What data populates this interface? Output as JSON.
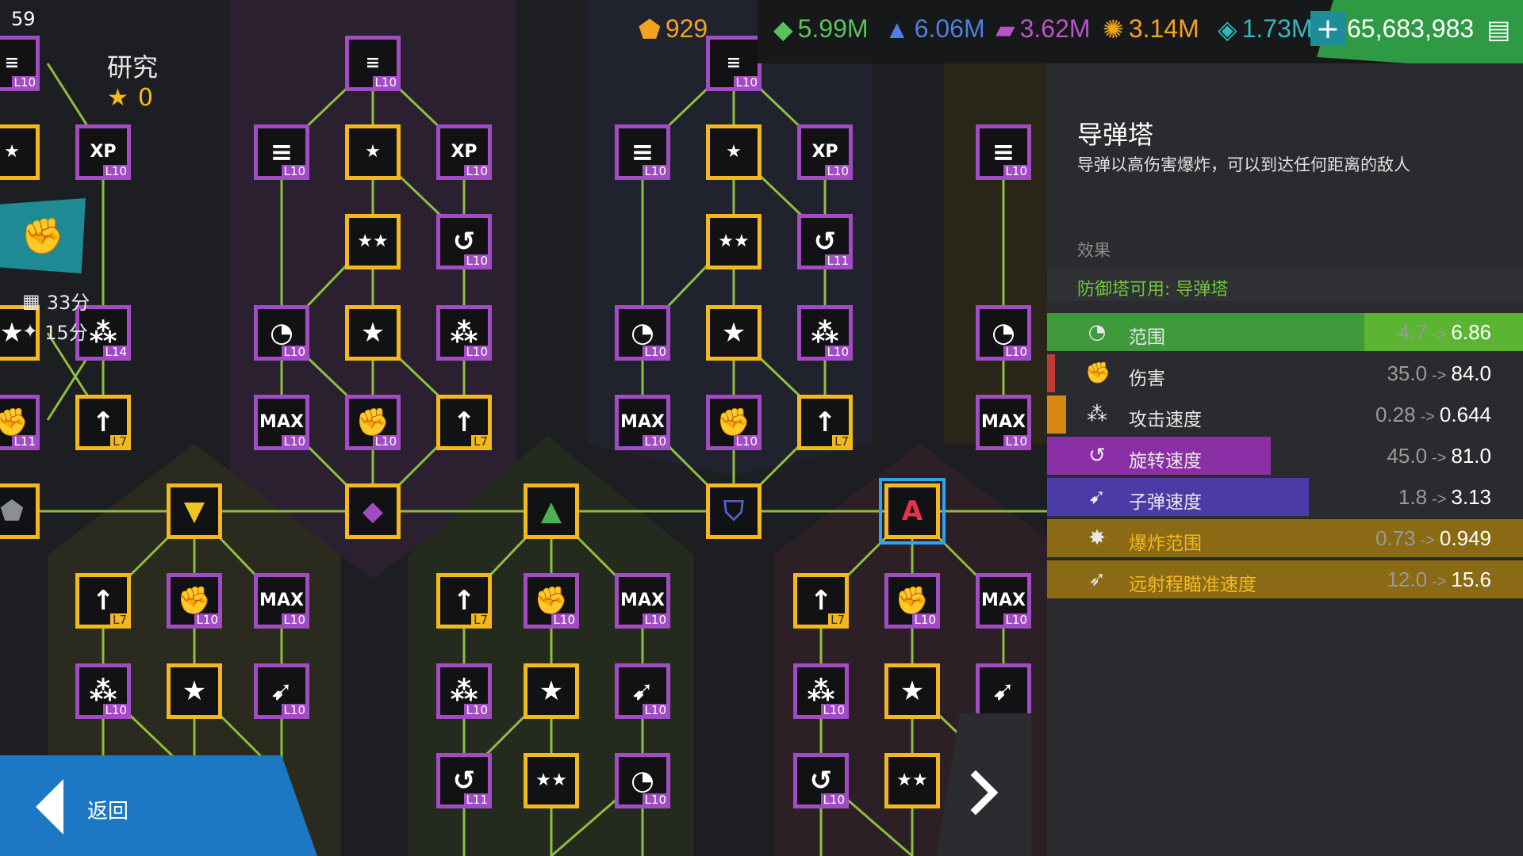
{
  "header": {
    "counter": "59",
    "title": "研究",
    "star_count": "0",
    "timer_1": "33分",
    "timer_2": "15分"
  },
  "resources": [
    {
      "icon": "pentagon-badge-icon",
      "value": "929",
      "color": "#f2a31e"
    },
    {
      "icon": "green-crystal-icon",
      "value": "5.99M",
      "color": "#59c35b"
    },
    {
      "icon": "blue-shard-icon",
      "value": "6.06M",
      "color": "#4f7fe0"
    },
    {
      "icon": "purple-stripes-icon",
      "value": "3.62M",
      "color": "#b655c9"
    },
    {
      "icon": "orange-mineral-icon",
      "value": "3.14M",
      "color": "#f2a31e"
    },
    {
      "icon": "teal-crystal-icon",
      "value": "1.73M",
      "color": "#34b7c0"
    },
    {
      "icon": "money-icon",
      "value": "65,683,983",
      "color": "#ffffff"
    }
  ],
  "panel": {
    "title": "导弹塔",
    "description": "导弹以高伤害爆炸，可以到达任何距离的敌人",
    "effects_label": "效果",
    "unlock_text": "防御塔可用: 导弹塔",
    "stats": [
      {
        "name": "范围",
        "icon": "range-icon",
        "from": "4.7",
        "to": "6.86",
        "color": "#3f9a3c",
        "fill": 1.0
      },
      {
        "name": "伤害",
        "icon": "damage-fist-icon",
        "from": "35.0",
        "to": "84.0",
        "color": "#c13a33",
        "fill": 0.01
      },
      {
        "name": "攻击速度",
        "icon": "attack-speed-icon",
        "from": "0.28",
        "to": "0.644",
        "color": "#d98714",
        "fill": 0.04
      },
      {
        "name": "旋转速度",
        "icon": "rotation-speed-icon",
        "from": "45.0",
        "to": "81.0",
        "color": "#8a2fa6",
        "fill": 0.47
      },
      {
        "name": "子弹速度",
        "icon": "bullet-speed-icon",
        "from": "1.8",
        "to": "3.13",
        "color": "#4c3ba6",
        "fill": 0.55
      },
      {
        "name": "爆炸范围",
        "icon": "explosion-range-icon",
        "from": "0.73",
        "to": "0.949",
        "color": "#8a6a14",
        "fill": 1.0
      },
      {
        "name": "远射程瞄准速度",
        "icon": "long-range-aim-icon",
        "from": "12.0",
        "to": "15.6",
        "color": "#8a6a14",
        "fill": 1.0
      }
    ]
  },
  "nav": {
    "back_label": "返回"
  },
  "tree_nodes": [
    {
      "name": "node-xp-l10",
      "glyph": "XP",
      "level": "L10",
      "gold": false
    },
    {
      "name": "node-star-stack",
      "glyph": "★",
      "level": "",
      "gold": true
    },
    {
      "name": "node-double-star",
      "glyph": "★★",
      "level": "",
      "gold": true
    },
    {
      "name": "node-range",
      "glyph": "◔",
      "level": "L10",
      "gold": false
    },
    {
      "name": "node-star",
      "glyph": "★",
      "level": "",
      "gold": true
    },
    {
      "name": "node-attack-speed",
      "glyph": "⁂",
      "level": "L10",
      "gold": false
    },
    {
      "name": "node-max-xp",
      "glyph": "MAX",
      "level": "L10",
      "gold": false
    },
    {
      "name": "node-damage",
      "glyph": "✊",
      "level": "L10",
      "gold": false
    },
    {
      "name": "node-upgrade-arrow",
      "glyph": "↑",
      "level": "L7",
      "gold": true
    },
    {
      "name": "node-rotation",
      "glyph": "↺",
      "level": "L10",
      "gold": false
    },
    {
      "name": "node-rotation-l11",
      "glyph": "↺",
      "level": "L11",
      "gold": false
    },
    {
      "name": "node-bullet-speed",
      "glyph": "➹",
      "level": "L10",
      "gold": false
    },
    {
      "name": "node-attack-speed-l14",
      "glyph": "⁂",
      "level": "L14",
      "gold": false
    },
    {
      "name": "node-damage-l11",
      "glyph": "✊",
      "level": "L11",
      "gold": false
    },
    {
      "name": "node-list",
      "glyph": "≡",
      "level": "L10",
      "gold": false
    },
    {
      "name": "node-tower-yellow",
      "glyph": "▼",
      "level": "",
      "gold": true
    },
    {
      "name": "node-tower-purple",
      "glyph": "◆",
      "level": "",
      "gold": true
    },
    {
      "name": "node-tower-green",
      "glyph": "▲",
      "level": "",
      "gold": true
    },
    {
      "name": "node-tower-blue",
      "glyph": "⛉",
      "level": "",
      "gold": true
    },
    {
      "name": "node-tower-missile",
      "glyph": "A",
      "level": "",
      "gold": true
    },
    {
      "name": "node-tower-grey",
      "glyph": "⬟",
      "level": "",
      "gold": true
    }
  ]
}
